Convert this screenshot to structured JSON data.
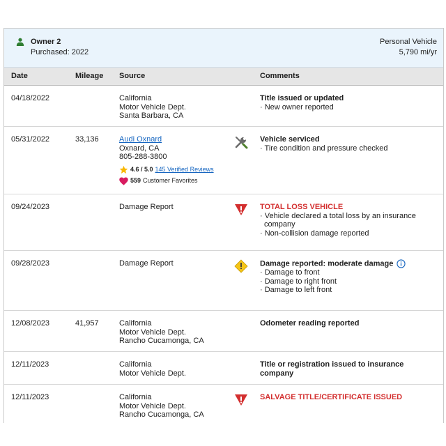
{
  "owner": {
    "name": "Owner 2",
    "purchased": "Purchased: 2022",
    "vehicle_type": "Personal Vehicle",
    "miles_per_year": "5,790 mi/yr"
  },
  "table": {
    "headers": {
      "date": "Date",
      "mileage": "Mileage",
      "source": "Source",
      "comments": "Comments"
    }
  },
  "rows": [
    {
      "date": "04/18/2022",
      "mileage": "",
      "source": [
        "California",
        "Motor Vehicle Dept.",
        "Santa Barbara, CA"
      ],
      "icon": "",
      "title": "Title issued or updated",
      "bullets": [
        "New owner reported"
      ]
    },
    {
      "date": "05/31/2022",
      "mileage": "33,136",
      "source_link": "Audi Oxnard",
      "source": [
        "Oxnard, CA",
        "805-288-3800"
      ],
      "rating_value": "4.6 / 5.0",
      "reviews_link": "145 Verified Reviews",
      "favorites_count": "559",
      "favorites_label": "Customer Favorites",
      "icon": "wrench-screwdriver-icon",
      "title": "Vehicle serviced",
      "bullets": [
        "Tire condition and pressure checked"
      ]
    },
    {
      "date": "09/24/2023",
      "mileage": "",
      "source": [
        "Damage Report"
      ],
      "icon": "red-warning-icon",
      "title": "TOTAL LOSS VEHICLE",
      "bullets": [
        "Vehicle declared a total loss by an insurance company",
        "Non-collision damage reported"
      ]
    },
    {
      "date": "09/28/2023",
      "mileage": "",
      "source": [
        "Damage Report"
      ],
      "icon": "yellow-warning-icon",
      "title": "Damage reported: moderate damage",
      "bullets": [
        "Damage to front",
        "Damage to right front",
        "Damage to left front"
      ]
    },
    {
      "date": "12/08/2023",
      "mileage": "41,957",
      "source": [
        "California",
        "Motor Vehicle Dept.",
        "Rancho Cucamonga, CA"
      ],
      "icon": "",
      "title": "Odometer reading reported",
      "bullets": []
    },
    {
      "date": "12/11/2023",
      "mileage": "",
      "source": [
        "California",
        "Motor Vehicle Dept."
      ],
      "icon": "",
      "title": "Title or registration issued to insurance company",
      "bullets": []
    },
    {
      "date": "12/11/2023",
      "mileage": "",
      "source": [
        "California",
        "Motor Vehicle Dept.",
        "Rancho Cucamonga, CA"
      ],
      "icon": "red-warning-icon",
      "title": "SALVAGE TITLE/CERTIFICATE ISSUED",
      "bullets": []
    }
  ],
  "colors": {
    "header_bg": "#eaf4fc",
    "table_head_bg": "#e6e6e6",
    "alert_red": "#d32f2f",
    "warning_yellow": "#f5c518",
    "link_blue": "#1565c0",
    "owner_icon_green": "#2e7d32",
    "favorite_pink": "#d81b60",
    "star_gold": "#f9b700"
  }
}
